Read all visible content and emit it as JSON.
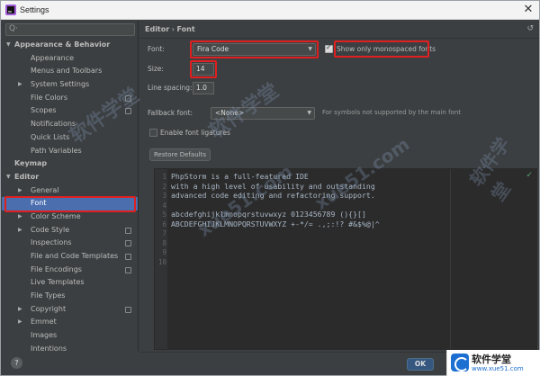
{
  "window": {
    "title": "Settings",
    "close_glyph": "✕"
  },
  "search": {
    "icon": "search-icon",
    "glyph": "Q·"
  },
  "tree": [
    {
      "label": "Appearance & Behavior",
      "level": 0,
      "expanded": true,
      "bold": true
    },
    {
      "label": "Appearance",
      "level": 1
    },
    {
      "label": "Menus and Toolbars",
      "level": 1
    },
    {
      "label": "System Settings",
      "level": 1,
      "collapsed": true
    },
    {
      "label": "File Colors",
      "level": 1,
      "project": true
    },
    {
      "label": "Scopes",
      "level": 1,
      "project": true
    },
    {
      "label": "Notifications",
      "level": 1
    },
    {
      "label": "Quick Lists",
      "level": 1
    },
    {
      "label": "Path Variables",
      "level": 1
    },
    {
      "label": "Keymap",
      "level": 0,
      "bold": true
    },
    {
      "label": "Editor",
      "level": 0,
      "expanded": true,
      "bold": true
    },
    {
      "label": "General",
      "level": 1,
      "collapsed": true
    },
    {
      "label": "Font",
      "level": 1,
      "selected": true
    },
    {
      "label": "Color Scheme",
      "level": 1,
      "collapsed": true
    },
    {
      "label": "Code Style",
      "level": 1,
      "collapsed": true,
      "project": true
    },
    {
      "label": "Inspections",
      "level": 1,
      "project": true
    },
    {
      "label": "File and Code Templates",
      "level": 1,
      "project": true
    },
    {
      "label": "File Encodings",
      "level": 1,
      "project": true
    },
    {
      "label": "Live Templates",
      "level": 1
    },
    {
      "label": "File Types",
      "level": 1
    },
    {
      "label": "Copyright",
      "level": 1,
      "collapsed": true,
      "project": true
    },
    {
      "label": "Emmet",
      "level": 1,
      "collapsed": true
    },
    {
      "label": "Images",
      "level": 1
    },
    {
      "label": "Intentions",
      "level": 1
    }
  ],
  "breadcrumb": {
    "parent": "Editor",
    "separator": "›",
    "current": "Font"
  },
  "reset_icon": "↺",
  "font": {
    "label": "Font:",
    "value": "Fira Code",
    "monospaced_label": "Show only monospaced fonts",
    "monospaced_checked": true
  },
  "size": {
    "label": "Size:",
    "value": "14"
  },
  "line_spacing": {
    "label": "Line spacing:",
    "value": "1.0"
  },
  "fallback": {
    "label": "Fallback font:",
    "value": "<None>",
    "hint": "For symbols not supported by the main font"
  },
  "ligatures": {
    "label": "Enable font ligatures",
    "checked": false
  },
  "restore_button": "Restore Defaults",
  "preview": {
    "line_numbers": [
      "1",
      "2",
      "3",
      "4",
      "5",
      "6",
      "7",
      "8",
      "9",
      "10"
    ],
    "lines": [
      "PhpStorm is a full-featured IDE",
      "with a high level of usability and outstanding",
      "advanced code editing and refactoring support.",
      "",
      "abcdefghijklmnopqrstuvwxyz 0123456789 (){}[]",
      "ABCDEFGHIJKLMNOPQRSTUVWXYZ +-*/= .,;:!? #&$%@|^",
      "",
      "",
      "",
      ""
    ],
    "check_icon": "✓"
  },
  "footer": {
    "ok_label": "OK",
    "help_glyph": "?"
  },
  "watermarks": [
    "软件学堂",
    "xue51.com",
    "软件学堂",
    "xue51.com",
    "软件学堂"
  ],
  "logo": {
    "name": "软件学堂",
    "url": "www.xue51.com"
  },
  "colors": {
    "highlight": "#e02020",
    "selection": "#4b6eaf",
    "ok_button": "#365880"
  }
}
